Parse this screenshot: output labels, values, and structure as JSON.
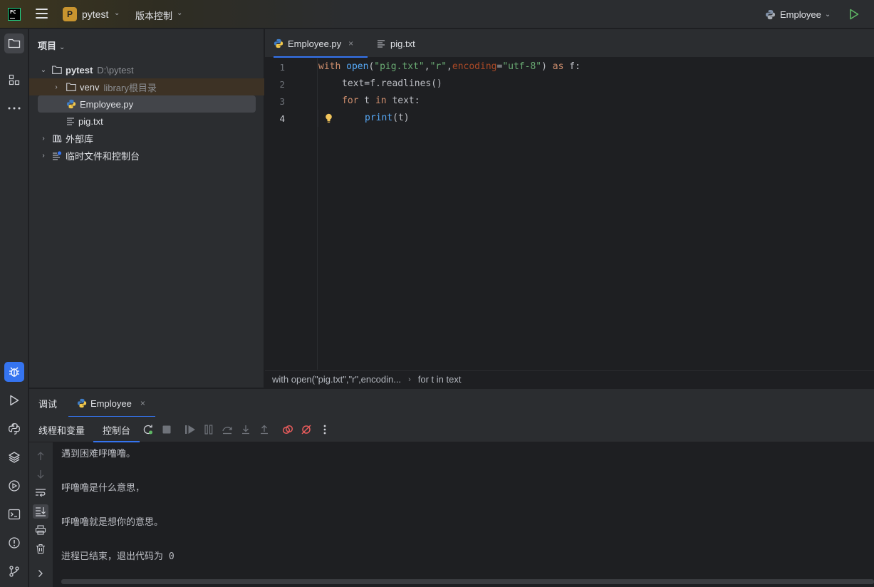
{
  "titlebar": {
    "project_badge": "P",
    "project_name": "pytest",
    "vcs_label": "版本控制",
    "run_config_name": "Employee"
  },
  "project_panel": {
    "header": "项目",
    "tree": [
      {
        "label": "pytest",
        "path": "D:\\pytest"
      },
      {
        "label": "venv",
        "note": "library根目录"
      },
      {
        "label": "Employee.py"
      },
      {
        "label": "pig.txt"
      },
      {
        "label": "外部库"
      },
      {
        "label": "临时文件和控制台"
      }
    ]
  },
  "editor": {
    "tabs": [
      {
        "label": "Employee.py",
        "close": "×"
      },
      {
        "label": "pig.txt"
      }
    ],
    "line_numbers": [
      "1",
      "2",
      "3",
      "4"
    ],
    "code": {
      "l1": {
        "kw_with": "with",
        "fn_open": "open",
        "p1": "(",
        "s1": "\"pig.txt\"",
        "c1": ",",
        "s2": "\"r\"",
        "c2": ",",
        "param": "encoding",
        "eq": "=",
        "s3": "\"utf-8\"",
        "p2": ") ",
        "kw_as": "as",
        "rest": " f:"
      },
      "l2": {
        "text": "text=f.readlines()"
      },
      "l3": {
        "kw_for": "for",
        "mid": " t ",
        "kw_in": "in",
        "rest": " text:"
      },
      "l4": {
        "fn_print": "print",
        "rest": "(t)"
      }
    },
    "breadcrumb": [
      "with open(\"pig.txt\",\"r\",encodin...",
      "for t in text"
    ]
  },
  "debug": {
    "tabs": [
      {
        "label": "调试"
      },
      {
        "label": "Employee",
        "close": "×"
      }
    ],
    "subtabs": [
      {
        "label": "线程和变量"
      },
      {
        "label": "控制台"
      }
    ],
    "console_lines": [
      "遇到困难呼噜噜。",
      "呼噜噜是什么意思，",
      "呼噜噜就是想你的意思。",
      "进程已结束，退出代码为 0"
    ]
  },
  "colors": {
    "accent": "#3574f0",
    "keyword": "#cf8e6d",
    "function": "#56a8f5",
    "string": "#6aab73",
    "param": "#aa4926",
    "run_green": "#5fb865",
    "stop_red": "#e55b5b"
  },
  "icons": {
    "toolstrip": [
      "folder-icon",
      "structure-icon",
      "more-icon",
      "debug-icon",
      "run-icon",
      "python-console-icon",
      "layers-icon",
      "services-icon",
      "terminal-icon",
      "problems-icon",
      "git-icon"
    ]
  }
}
